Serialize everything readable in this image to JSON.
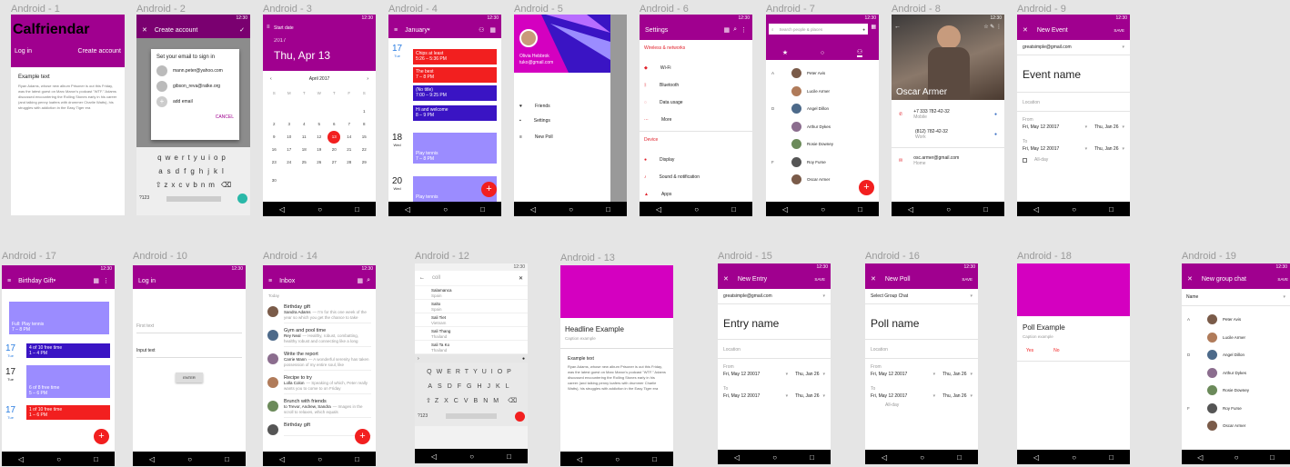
{
  "f1": {
    "label": "Android - 1",
    "title": "Calfriendar",
    "login": "Log in",
    "create": "Create account",
    "ex_title": "Example text",
    "ex_body": "Ryan Adams, whose new album Prisoner is out this Friday, was the latest guest on Marc Maron's podcast \"WTF.\" Adams discussed encountering the Rolling Stones early in his career (and talking penny loafers with drummer Charlie Watts), his struggles with addiction in the Easy Tiger era"
  },
  "f2": {
    "label": "Android - 2",
    "title": "Create account",
    "dialog_title": "Set your email to sign in",
    "emails": [
      "mann.peter@yahoo.com",
      "gibson_reva@ratke.org"
    ],
    "add": "add email",
    "cancel": "CANCEL",
    "kb1": "qwertyuiop",
    "kb2": "asdfghjkl",
    "kb3": "zxcvbnm",
    "sym": "?123"
  },
  "f3": {
    "label": "Android - 3",
    "start": "Start date",
    "year": "2017",
    "date": "Thu, Apr 13",
    "month": "April 2017",
    "days": [
      "S",
      "M",
      "T",
      "W",
      "T",
      "F",
      "S"
    ],
    "sel": "13"
  },
  "f4": {
    "label": "Android - 4",
    "month": "January",
    "d1": "17",
    "d1w": "Tue",
    "events": [
      "Chips at least",
      "The best",
      "(No title)",
      "Hi and welcome"
    ],
    "times": [
      "5:26 – 5:36 PM",
      "7 – 8 PM",
      "7:00 – 9:25 PM",
      "8 – 9 PM"
    ],
    "d2": "18",
    "d2w": "Wed",
    "play1": "Play tennis",
    "play1t": "7 – 8 PM",
    "d3": "20",
    "d3w": "Wed",
    "play2": "Play tennis"
  },
  "f5": {
    "label": "Android - 5",
    "name": "Olivia Hebbrok",
    "email": "tuko@gmail.com",
    "items": [
      "Friends",
      "Settings",
      "New Poll"
    ]
  },
  "f6": {
    "label": "Android - 6",
    "title": "Settings",
    "sec1": "Wireless & networks",
    "items1": [
      "Wi-Fi",
      "Bluetooth",
      "Data usage",
      "More"
    ],
    "sec2": "Device",
    "items2": [
      "Display",
      "Sound & notification",
      "Apps"
    ]
  },
  "f7": {
    "label": "Android - 7",
    "search": "Search people & places",
    "letters": [
      "A",
      "D",
      "F"
    ],
    "people": [
      "Peter Avis",
      "Lucile Armer",
      "Angel Dillon",
      "Arthur Dykes",
      "Rosie Downey",
      "Roy Furse",
      "Oscar Armer"
    ]
  },
  "f8": {
    "label": "Android - 8",
    "name": "Oscar Armer",
    "phone1": "+7 333 782-42-32",
    "phone1t": "Mobile",
    "phone2": "(812) 782-42-32",
    "phone2t": "Work",
    "email": "osc.armer@gmail.com",
    "emailt": "Home"
  },
  "f9": {
    "label": "Android - 9",
    "title": "New Event",
    "save": "SAVE",
    "account": "greatsimple@gmail.com",
    "name": "Event name",
    "location": "Location",
    "from": "From",
    "from_date": "Fri, May 12 20017",
    "from_day": "Thu, Jan 26",
    "to": "To",
    "to_date": "Fri, May 12 20017",
    "to_day": "Thu, Jan 26",
    "allday": "All-day"
  },
  "f17": {
    "label": "Android - 17",
    "title": "Birthday Gift",
    "d1": "17",
    "d1w": "Tue",
    "e1": "Full: Play tennis",
    "e1t": "7 – 8 PM",
    "e2": "4 of 10 free time",
    "e2t": "1 – 4 PM",
    "d2": "17",
    "d2w": "Tue",
    "e3": "6 of 8 free time",
    "e3t": "5 – 6 PM",
    "d3": "17",
    "d3w": "Tue",
    "e4": "1 of 10 free time",
    "e4t": "1 – 6 PM"
  },
  "f10": {
    "label": "Android - 10",
    "title": "Log in",
    "f1": "First text",
    "f2": "Input text",
    "btn": "ENTER"
  },
  "f14": {
    "label": "Android - 14",
    "title": "Inbox",
    "today": "Today",
    "mails": [
      {
        "t": "Birthday gift",
        "s": "Sandra Adams",
        "p": "— I'm for this one week of the year so which you get the chance to take"
      },
      {
        "t": "Gym and pool time",
        "s": "Rey Neal",
        "p": "— Healthy, robust, combatting, healthy robust and connecting like a long"
      },
      {
        "t": "Write the report",
        "s": "Carrie Mann",
        "p": "— A wonderful serenity has taken possession of my entire soul, like"
      },
      {
        "t": "Recipe to try",
        "s": "Lolla Colon",
        "p": "— Speaking of which, Peter really wants you to come to on Friday"
      },
      {
        "t": "Brunch with friends",
        "s": "to Trevor, Andrew, Sandra",
        "p": "— Images in the scroll to relaxes, which equals"
      },
      {
        "t": "Birthday gift",
        "s": "",
        "p": ""
      }
    ]
  },
  "f12": {
    "label": "Android - 12",
    "query": "coll",
    "results": [
      {
        "t": "Salamanca",
        "s": "Spain"
      },
      {
        "t": "Salto",
        "s": "Spain"
      },
      {
        "t": "Sali Tiet",
        "s": "Vietnam"
      },
      {
        "t": "Sali Thang",
        "s": "Thailand"
      },
      {
        "t": "Sali Ta Ko",
        "s": "Thailand"
      }
    ],
    "kb1": "QWERTYUIOP",
    "kb2": "ASDFGHJKL",
    "kb3": "ZXCVBNM",
    "sym": "?123"
  },
  "f13": {
    "label": "Android - 13",
    "headline": "Headline Example",
    "caption": "Caption example",
    "ex_title": "Example text",
    "ex_body": "Ryan Adams, whose new album Prisoner is out this Friday, was the latest guest on Marc Maron's podcast \"WTF.\" Adams discussed encountering the Rolling Stones early in his career (and talking penny loafers with drummer Charlie Watts), his struggles with addiction in the Easy Tiger era"
  },
  "f15": {
    "label": "Android - 15",
    "title": "New Entry",
    "save": "SAVE",
    "account": "greatsimple@gmail.com",
    "name": "Entry name",
    "location": "Location",
    "from": "From",
    "from_date": "Fri, May 12 20017",
    "from_day": "Thu, Jan 26",
    "to": "To",
    "to_date": "Fri, May 12 20017",
    "to_day": "Thu, Jan 26"
  },
  "f16": {
    "label": "Android - 16",
    "title": "New Poll",
    "save": "SAVE",
    "select": "Select Group Chat",
    "name": "Poll name",
    "location": "Location",
    "from": "From",
    "from_date": "Fri, May 12 20017",
    "from_day": "Thu, Jan 26",
    "to": "To",
    "to_date": "Fri, May 12 20017",
    "to_day": "Thu, Jan 26",
    "allday": "All-day"
  },
  "f18": {
    "label": "Android - 18",
    "title": "Poll Example",
    "caption": "Caption example",
    "yes": "Yes",
    "no": "No"
  },
  "f19": {
    "label": "Android - 19",
    "title": "New group chat",
    "save": "SAVE",
    "name": "Name",
    "letters": [
      "A",
      "D",
      "F"
    ],
    "people": [
      "Peter Avis",
      "Lucile Armer",
      "Angel Dillon",
      "Arthur Dykes",
      "Rosie Downey",
      "Roy Furse",
      "Oscar Armer"
    ]
  },
  "status": "12:30",
  "colors": {
    "primary": "#a0008f",
    "accent": "#f21f1f",
    "magenta": "#d400c0",
    "blue": "#3a14c4",
    "periwinkle": "#9b8cff"
  }
}
